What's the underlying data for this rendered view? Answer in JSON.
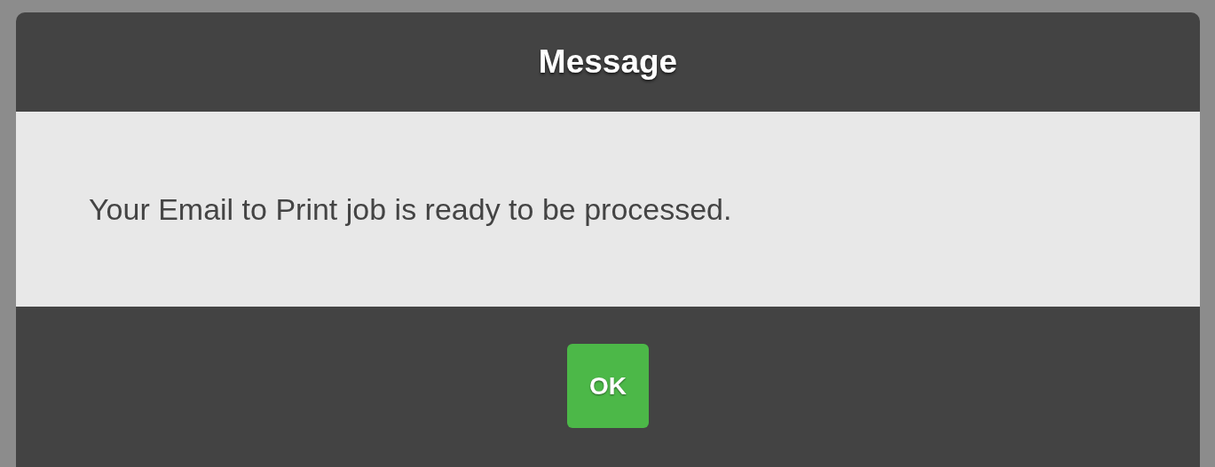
{
  "dialog": {
    "title": "Message",
    "message": "Your Email to Print job is ready to be processed.",
    "buttons": [
      "OK"
    ]
  }
}
